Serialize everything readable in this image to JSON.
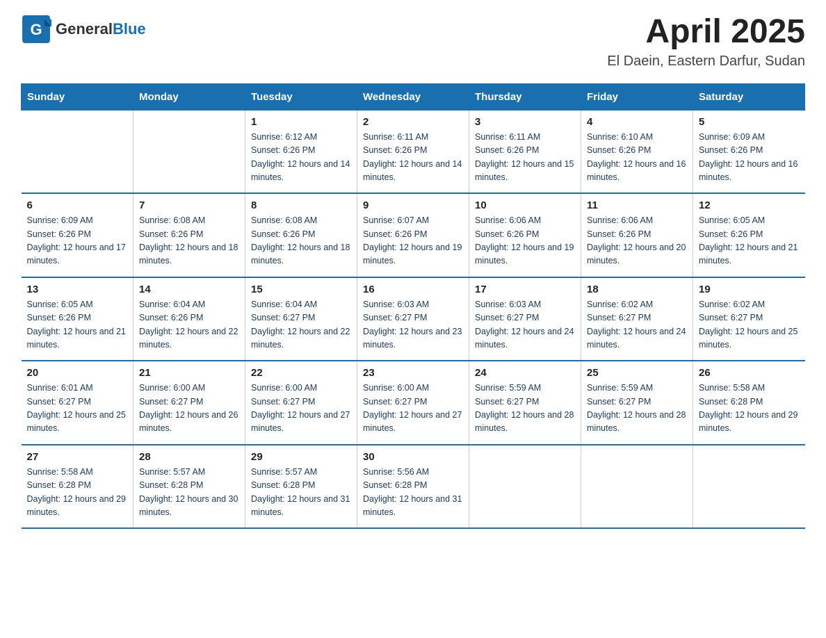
{
  "header": {
    "logo_text_general": "General",
    "logo_text_blue": "Blue",
    "month_year": "April 2025",
    "location": "El Daein, Eastern Darfur, Sudan"
  },
  "weekdays": [
    "Sunday",
    "Monday",
    "Tuesday",
    "Wednesday",
    "Thursday",
    "Friday",
    "Saturday"
  ],
  "weeks": [
    [
      {
        "day": "",
        "sunrise": "",
        "sunset": "",
        "daylight": ""
      },
      {
        "day": "",
        "sunrise": "",
        "sunset": "",
        "daylight": ""
      },
      {
        "day": "1",
        "sunrise": "Sunrise: 6:12 AM",
        "sunset": "Sunset: 6:26 PM",
        "daylight": "Daylight: 12 hours and 14 minutes."
      },
      {
        "day": "2",
        "sunrise": "Sunrise: 6:11 AM",
        "sunset": "Sunset: 6:26 PM",
        "daylight": "Daylight: 12 hours and 14 minutes."
      },
      {
        "day": "3",
        "sunrise": "Sunrise: 6:11 AM",
        "sunset": "Sunset: 6:26 PM",
        "daylight": "Daylight: 12 hours and 15 minutes."
      },
      {
        "day": "4",
        "sunrise": "Sunrise: 6:10 AM",
        "sunset": "Sunset: 6:26 PM",
        "daylight": "Daylight: 12 hours and 16 minutes."
      },
      {
        "day": "5",
        "sunrise": "Sunrise: 6:09 AM",
        "sunset": "Sunset: 6:26 PM",
        "daylight": "Daylight: 12 hours and 16 minutes."
      }
    ],
    [
      {
        "day": "6",
        "sunrise": "Sunrise: 6:09 AM",
        "sunset": "Sunset: 6:26 PM",
        "daylight": "Daylight: 12 hours and 17 minutes."
      },
      {
        "day": "7",
        "sunrise": "Sunrise: 6:08 AM",
        "sunset": "Sunset: 6:26 PM",
        "daylight": "Daylight: 12 hours and 18 minutes."
      },
      {
        "day": "8",
        "sunrise": "Sunrise: 6:08 AM",
        "sunset": "Sunset: 6:26 PM",
        "daylight": "Daylight: 12 hours and 18 minutes."
      },
      {
        "day": "9",
        "sunrise": "Sunrise: 6:07 AM",
        "sunset": "Sunset: 6:26 PM",
        "daylight": "Daylight: 12 hours and 19 minutes."
      },
      {
        "day": "10",
        "sunrise": "Sunrise: 6:06 AM",
        "sunset": "Sunset: 6:26 PM",
        "daylight": "Daylight: 12 hours and 19 minutes."
      },
      {
        "day": "11",
        "sunrise": "Sunrise: 6:06 AM",
        "sunset": "Sunset: 6:26 PM",
        "daylight": "Daylight: 12 hours and 20 minutes."
      },
      {
        "day": "12",
        "sunrise": "Sunrise: 6:05 AM",
        "sunset": "Sunset: 6:26 PM",
        "daylight": "Daylight: 12 hours and 21 minutes."
      }
    ],
    [
      {
        "day": "13",
        "sunrise": "Sunrise: 6:05 AM",
        "sunset": "Sunset: 6:26 PM",
        "daylight": "Daylight: 12 hours and 21 minutes."
      },
      {
        "day": "14",
        "sunrise": "Sunrise: 6:04 AM",
        "sunset": "Sunset: 6:26 PM",
        "daylight": "Daylight: 12 hours and 22 minutes."
      },
      {
        "day": "15",
        "sunrise": "Sunrise: 6:04 AM",
        "sunset": "Sunset: 6:27 PM",
        "daylight": "Daylight: 12 hours and 22 minutes."
      },
      {
        "day": "16",
        "sunrise": "Sunrise: 6:03 AM",
        "sunset": "Sunset: 6:27 PM",
        "daylight": "Daylight: 12 hours and 23 minutes."
      },
      {
        "day": "17",
        "sunrise": "Sunrise: 6:03 AM",
        "sunset": "Sunset: 6:27 PM",
        "daylight": "Daylight: 12 hours and 24 minutes."
      },
      {
        "day": "18",
        "sunrise": "Sunrise: 6:02 AM",
        "sunset": "Sunset: 6:27 PM",
        "daylight": "Daylight: 12 hours and 24 minutes."
      },
      {
        "day": "19",
        "sunrise": "Sunrise: 6:02 AM",
        "sunset": "Sunset: 6:27 PM",
        "daylight": "Daylight: 12 hours and 25 minutes."
      }
    ],
    [
      {
        "day": "20",
        "sunrise": "Sunrise: 6:01 AM",
        "sunset": "Sunset: 6:27 PM",
        "daylight": "Daylight: 12 hours and 25 minutes."
      },
      {
        "day": "21",
        "sunrise": "Sunrise: 6:00 AM",
        "sunset": "Sunset: 6:27 PM",
        "daylight": "Daylight: 12 hours and 26 minutes."
      },
      {
        "day": "22",
        "sunrise": "Sunrise: 6:00 AM",
        "sunset": "Sunset: 6:27 PM",
        "daylight": "Daylight: 12 hours and 27 minutes."
      },
      {
        "day": "23",
        "sunrise": "Sunrise: 6:00 AM",
        "sunset": "Sunset: 6:27 PM",
        "daylight": "Daylight: 12 hours and 27 minutes."
      },
      {
        "day": "24",
        "sunrise": "Sunrise: 5:59 AM",
        "sunset": "Sunset: 6:27 PM",
        "daylight": "Daylight: 12 hours and 28 minutes."
      },
      {
        "day": "25",
        "sunrise": "Sunrise: 5:59 AM",
        "sunset": "Sunset: 6:27 PM",
        "daylight": "Daylight: 12 hours and 28 minutes."
      },
      {
        "day": "26",
        "sunrise": "Sunrise: 5:58 AM",
        "sunset": "Sunset: 6:28 PM",
        "daylight": "Daylight: 12 hours and 29 minutes."
      }
    ],
    [
      {
        "day": "27",
        "sunrise": "Sunrise: 5:58 AM",
        "sunset": "Sunset: 6:28 PM",
        "daylight": "Daylight: 12 hours and 29 minutes."
      },
      {
        "day": "28",
        "sunrise": "Sunrise: 5:57 AM",
        "sunset": "Sunset: 6:28 PM",
        "daylight": "Daylight: 12 hours and 30 minutes."
      },
      {
        "day": "29",
        "sunrise": "Sunrise: 5:57 AM",
        "sunset": "Sunset: 6:28 PM",
        "daylight": "Daylight: 12 hours and 31 minutes."
      },
      {
        "day": "30",
        "sunrise": "Sunrise: 5:56 AM",
        "sunset": "Sunset: 6:28 PM",
        "daylight": "Daylight: 12 hours and 31 minutes."
      },
      {
        "day": "",
        "sunrise": "",
        "sunset": "",
        "daylight": ""
      },
      {
        "day": "",
        "sunrise": "",
        "sunset": "",
        "daylight": ""
      },
      {
        "day": "",
        "sunrise": "",
        "sunset": "",
        "daylight": ""
      }
    ]
  ]
}
